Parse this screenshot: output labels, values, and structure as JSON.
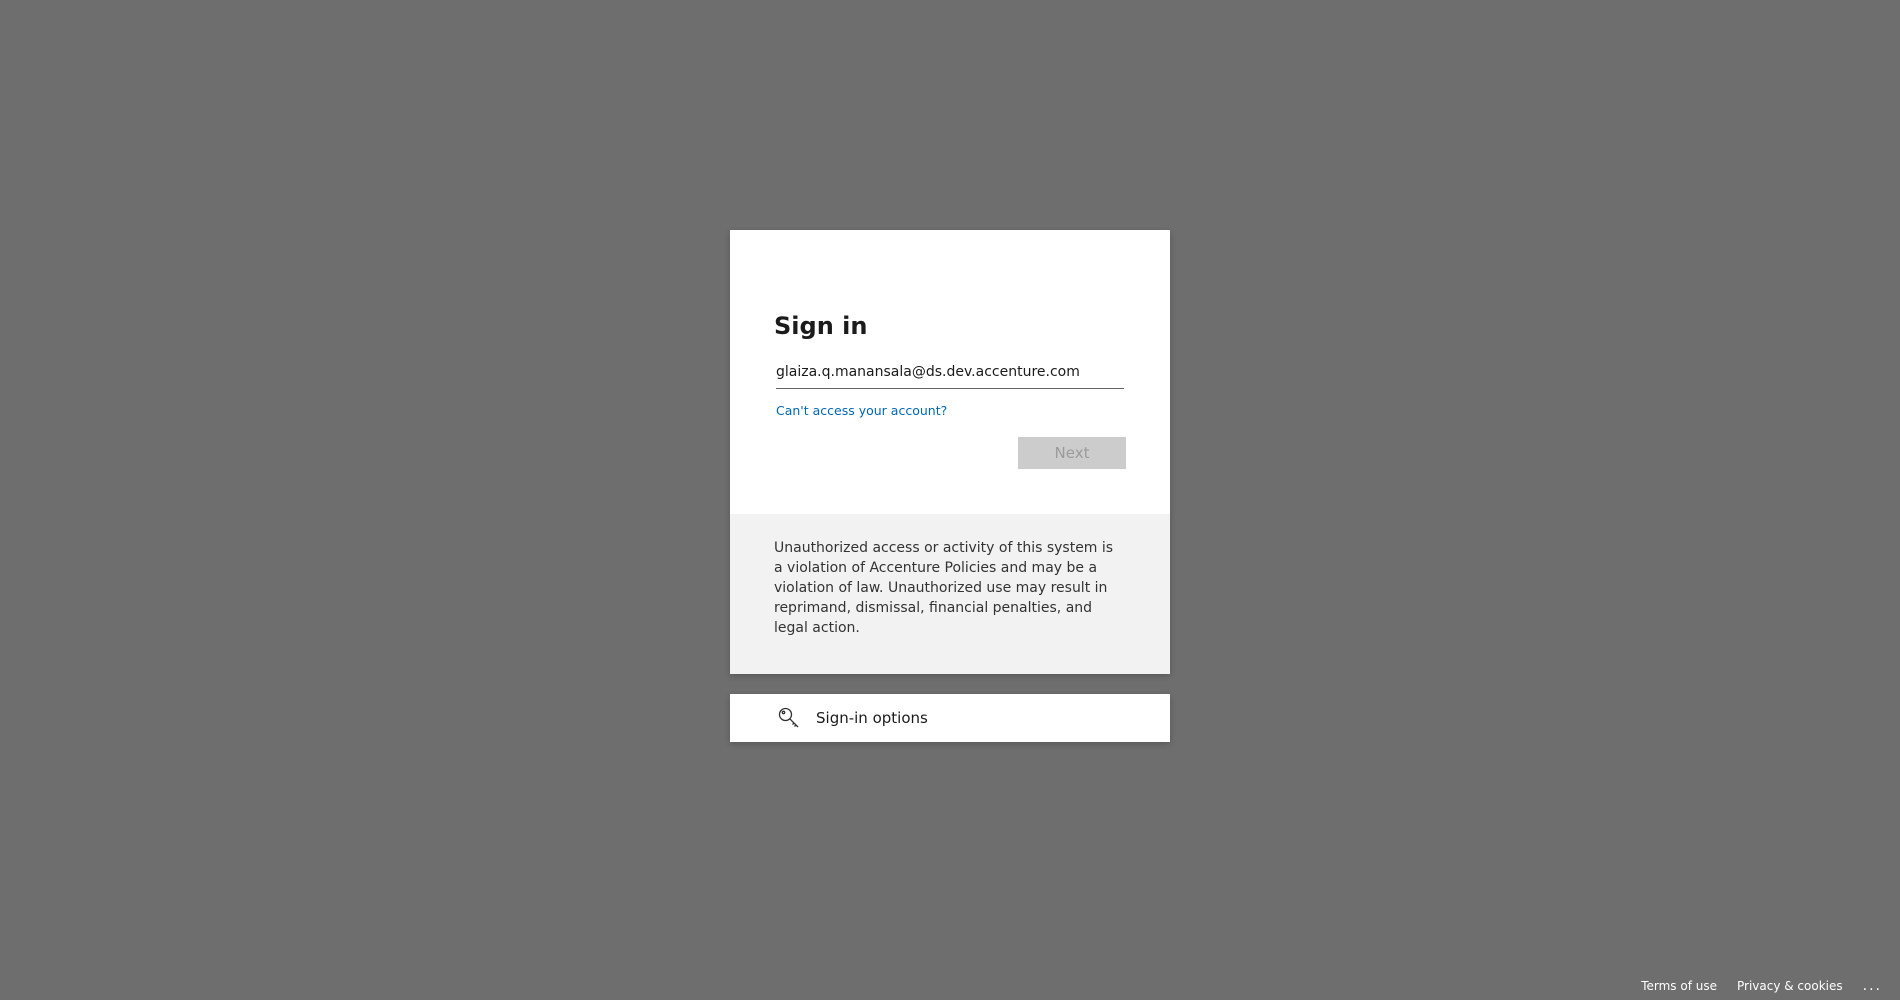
{
  "signin": {
    "title": "Sign in",
    "email_value": "glaiza.q.manansala@ds.dev.accenture.com",
    "cant_access_link": "Can't access your account?",
    "next_label": "Next"
  },
  "notice": {
    "text": "Unauthorized access or activity of this system is a violation of Accenture Policies and may be a violation of law. Unauthorized use may result in reprimand, dismissal, financial penalties, and legal action."
  },
  "options": {
    "label": "Sign-in options",
    "icon": "key-icon"
  },
  "footer": {
    "terms": "Terms of use",
    "privacy": "Privacy & cookies",
    "more": "..."
  },
  "colors": {
    "background": "#6e6e6e",
    "link": "#0067b8",
    "button_disabled": "#cccccc",
    "notice_bg": "#f2f2f2"
  }
}
